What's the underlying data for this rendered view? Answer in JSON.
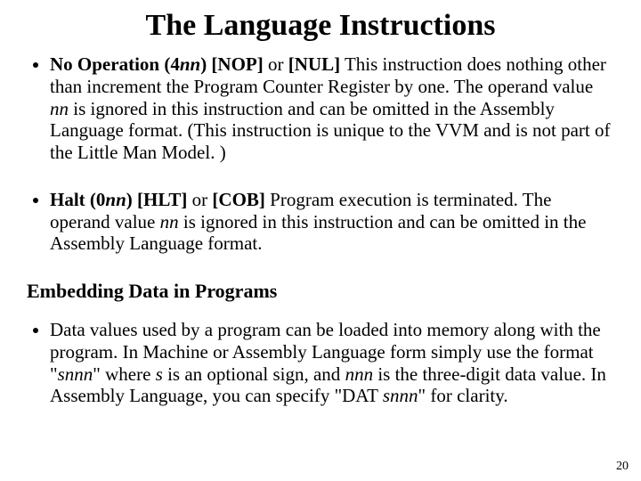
{
  "title": "The Language Instructions",
  "bullets": {
    "nop": {
      "lead_b": "No Operation (4",
      "lead_nn": "nn",
      "lead_b2": ") [NOP]",
      "or": " or ",
      "alt_b": "[NUL]",
      "text1": " This instruction does nothing other than increment the Program Counter Register by one. The operand value ",
      "nn": "nn",
      "text2": " is ignored in this instruction and can be omitted in the Assembly Language format. (This instruction is unique to the VVM and is not part of the Little Man Model. )"
    },
    "hlt": {
      "lead_b": "Halt (0",
      "lead_nn": "nn",
      "lead_b2": ") [HLT]",
      "or": " or ",
      "alt_b": "[COB]",
      "text1": " Program execution is terminated. The operand value ",
      "nn": "nn",
      "text2": " is ignored in this instruction and can be omitted in the Assembly Language format."
    },
    "data": {
      "text1": "Data values used by a program can be loaded into memory along with the program. In Machine or Assembly Language form simply use the format \"",
      "snnn1_s": "s",
      "snnn1_n": "nnn",
      "text2": "\" where ",
      "s": "s",
      "text3": " is an optional sign, and ",
      "nnn": "nnn",
      "text4": "  is the three-digit data value. In Assembly Language, you can specify \"DAT ",
      "snnn2_s": "s",
      "snnn2_n": "nnn",
      "text5": "\" for clarity."
    }
  },
  "subhead": "Embedding Data in Programs",
  "page_number": "20"
}
